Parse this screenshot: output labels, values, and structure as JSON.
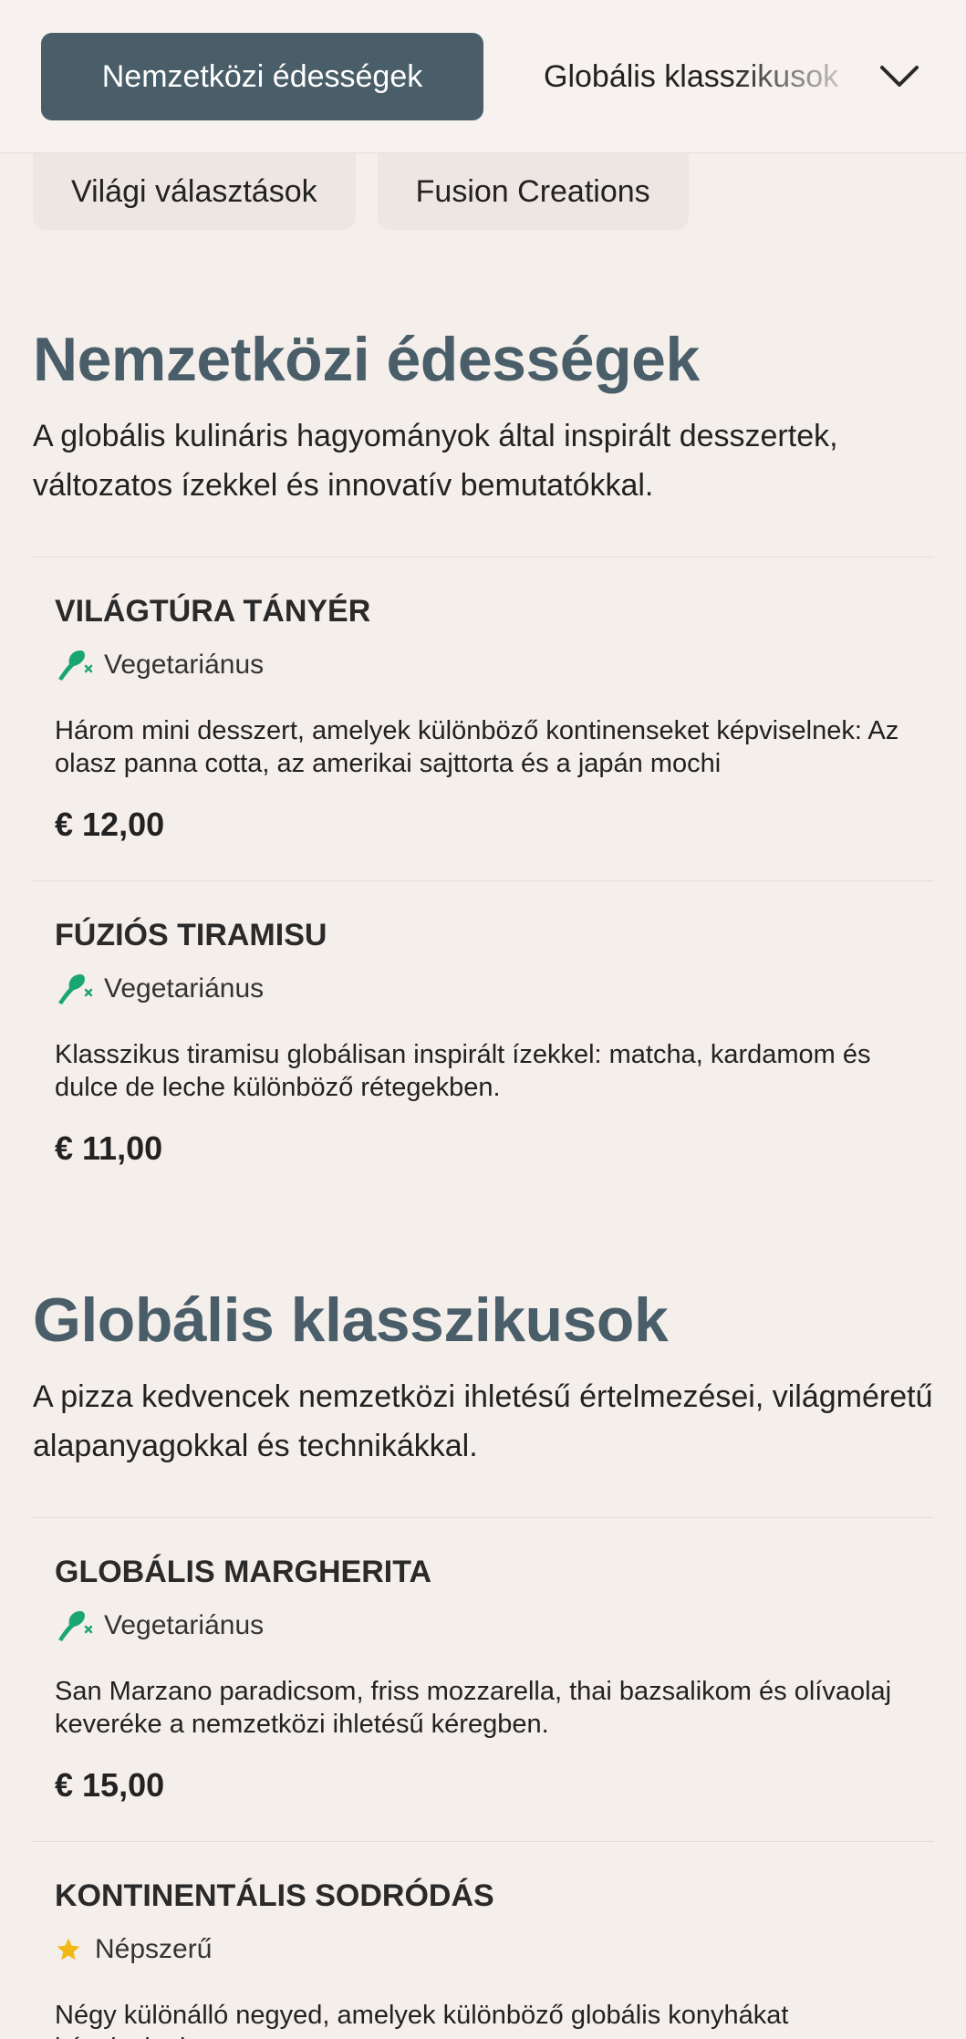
{
  "categories": {
    "active": "Nemzetközi édességek",
    "next": "Globális klasszikusok",
    "row2": [
      "Világi választások",
      "Fusion Creations"
    ]
  },
  "colors": {
    "accent": "#4a5e69",
    "background": "#f5efeb",
    "vegetarian_icon": "#1aa673",
    "popular_icon": "#f2b816"
  },
  "sections": [
    {
      "title": "Nemzetközi édességek",
      "description": "A globális kulináris hagyományok által inspirált desszertek, változatos ízekkel és innovatív bemutatókkal.",
      "items": [
        {
          "name": "VILÁGTÚRA TÁNYÉR",
          "tag": "Vegetariánus",
          "tag_icon": "vegetarian-icon",
          "description": "Három mini desszert, amelyek különböző kontinenseket képviselnek: Az olasz panna cotta, az amerikai sajttorta és a japán mochi",
          "price": "€ 12,00"
        },
        {
          "name": "FÚZIÓS TIRAMISU",
          "tag": "Vegetariánus",
          "tag_icon": "vegetarian-icon",
          "description": "Klasszikus tiramisu globálisan inspirált ízekkel: matcha, kardamom és dulce de leche különböző rétegekben.",
          "price": "€ 11,00"
        }
      ]
    },
    {
      "title": "Globális klasszikusok",
      "description": "A pizza kedvencek nemzetközi ihletésű értelmezései, világméretű alapanyagokkal és technikákkal.",
      "items": [
        {
          "name": "GLOBÁLIS MARGHERITA",
          "tag": "Vegetariánus",
          "tag_icon": "vegetarian-icon",
          "description": "San Marzano paradicsom, friss mozzarella, thai bazsalikom és olívaolaj keveréke a nemzetközi ihletésű kéregben.",
          "price": "€ 15,00"
        },
        {
          "name": "KONTINENTÁLIS SODRÓDÁS",
          "tag": "Népszerű",
          "tag_icon": "star-icon",
          "description": "Négy különálló negyed, amelyek különböző globális konyhákat képviselnek"
        }
      ]
    }
  ]
}
